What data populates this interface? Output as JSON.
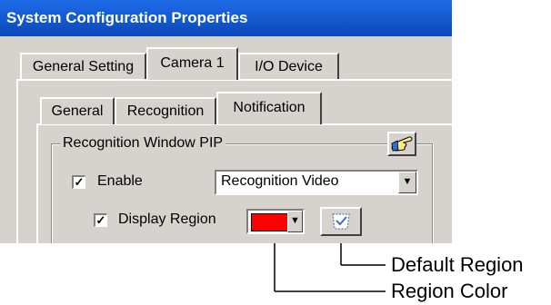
{
  "window": {
    "title": "System Configuration Properties"
  },
  "tabs_top": [
    {
      "label": "General Setting",
      "active": false
    },
    {
      "label": "Camera 1",
      "active": true
    },
    {
      "label": "I/O Device",
      "active": false
    }
  ],
  "tabs_sub": [
    {
      "label": "General",
      "active": false
    },
    {
      "label": "Recognition",
      "active": false
    },
    {
      "label": "Notification",
      "active": true
    }
  ],
  "group": {
    "title": "Recognition Window PIP",
    "icon": "pointing-hand-icon"
  },
  "enable": {
    "checked": true,
    "check_mark": "✓",
    "label": "Enable"
  },
  "video_select": {
    "value": "Recognition Video"
  },
  "display_region": {
    "checked": true,
    "check_mark": "✓",
    "label": "Display Region"
  },
  "region_color": {
    "value": "#ff0000"
  },
  "default_region_button": {
    "icon": "default-region-icon"
  },
  "callouts": {
    "default_region": "Default Region",
    "region_color": "Region Color"
  }
}
